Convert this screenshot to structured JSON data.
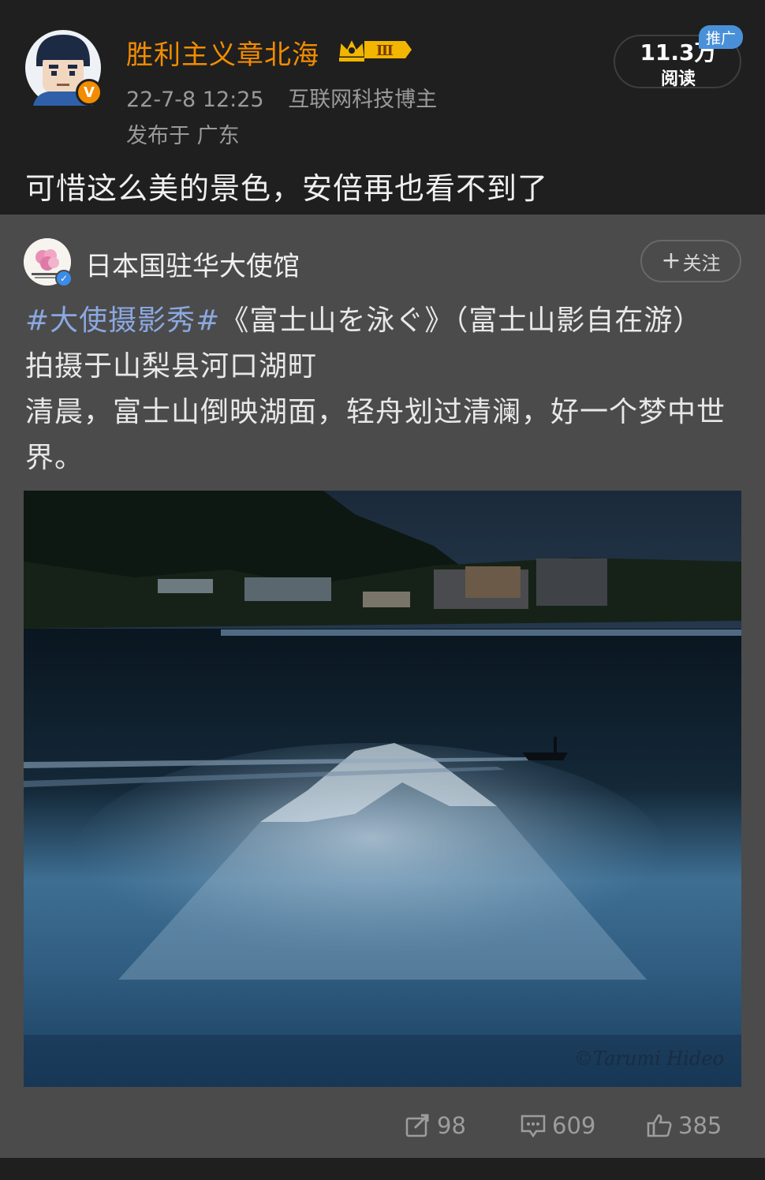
{
  "header": {
    "author_name": "胜利主义章北海",
    "level": "Ⅲ",
    "timestamp": "22-7-8 12:25",
    "author_tag": "互联网科技博主",
    "location": "发布于 广东",
    "reads_count": "11.3万",
    "reads_label": "阅读",
    "promo_tag": "推广",
    "verified_badge": "V"
  },
  "post": {
    "text": "可惜这么美的景色，安倍再也看不到了"
  },
  "repost": {
    "author_name": "日本国驻华大使馆",
    "follow_label": "关注",
    "hashtag": "#大使摄影秀#",
    "text_line1": "《富士山を泳ぐ》（富士山影自在游）",
    "text_line2": "拍摄于山梨县河口湖町",
    "text_line3": "清晨，富士山倒映湖面，轻舟划过清澜，好一个梦中世界。",
    "photo_watermark": "©Tarumi Hideo"
  },
  "actions": {
    "reposts": "98",
    "comments": "609",
    "likes": "385"
  },
  "colors": {
    "accent_orange": "#f28c00",
    "hashtag_blue": "#8ba8e0",
    "dark_bg": "#1f1f1f",
    "card_bg": "#4b4b4b"
  }
}
